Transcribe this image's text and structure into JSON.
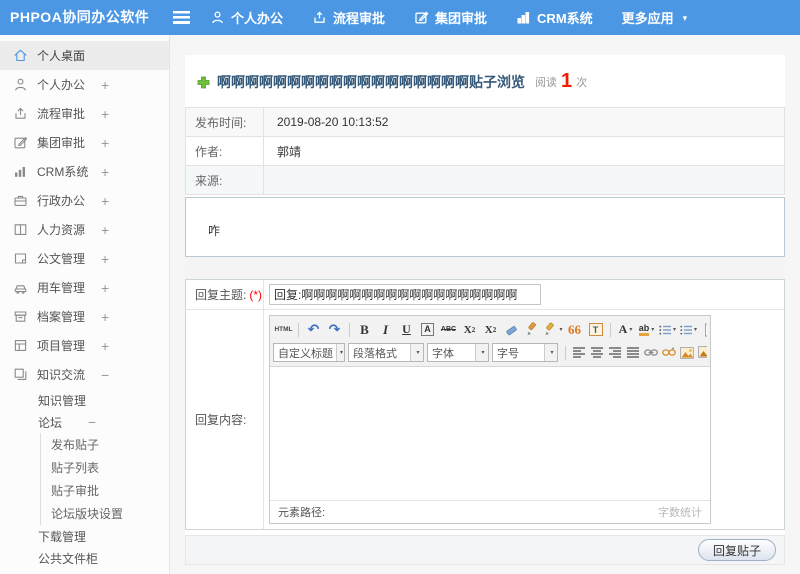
{
  "colors": {
    "topbar_blue": "#4c97e4",
    "title_blue": "#35597a",
    "read_count_red": "#f21d00",
    "plus_green": "#6fbf3f",
    "required_red": "#ff0000"
  },
  "topbar": {
    "brand": "PHPOA协同办公软件",
    "nav": [
      {
        "label": "个人办公",
        "icon": "person-icon"
      },
      {
        "label": "流程审批",
        "icon": "workflow-icon"
      },
      {
        "label": "集团审批",
        "icon": "group-approval-icon"
      },
      {
        "label": "CRM系统",
        "icon": "chart-icon"
      },
      {
        "label": "更多应用",
        "icon": "caret-down-icon"
      }
    ],
    "more_caret": "▾"
  },
  "sidebar": {
    "items": [
      {
        "label": "个人桌面",
        "expand": ""
      },
      {
        "label": "个人办公",
        "expand": "+"
      },
      {
        "label": "流程审批",
        "expand": "+"
      },
      {
        "label": "集团审批",
        "expand": "+"
      },
      {
        "label": "CRM系统",
        "expand": "+"
      },
      {
        "label": "行政办公",
        "expand": "+"
      },
      {
        "label": "人力资源",
        "expand": "+"
      },
      {
        "label": "公文管理",
        "expand": "+"
      },
      {
        "label": "用车管理",
        "expand": "+"
      },
      {
        "label": "档案管理",
        "expand": "+"
      },
      {
        "label": "项目管理",
        "expand": "+"
      },
      {
        "label": "知识交流",
        "expand": "−"
      },
      {
        "label": "知识管理",
        "expand": ""
      },
      {
        "label": "论坛",
        "expand": "−"
      },
      {
        "label": "发布贴子",
        "expand": ""
      },
      {
        "label": "贴子列表",
        "expand": ""
      },
      {
        "label": "贴子审批",
        "expand": ""
      },
      {
        "label": "论坛版块设置",
        "expand": ""
      },
      {
        "label": "下载管理",
        "expand": ""
      },
      {
        "label": "公共文件柜",
        "expand": ""
      }
    ]
  },
  "main": {
    "title": "啊啊啊啊啊啊啊啊啊啊啊啊啊啊啊啊啊啊贴子浏览",
    "read_label": "阅读",
    "read_count": "1",
    "read_unit": "次",
    "info_rows": [
      {
        "label": "发布时间:",
        "value": "2019-08-20 10:13:52"
      },
      {
        "label": "作者:",
        "value": "郭靖"
      },
      {
        "label": "来源:",
        "value": ""
      }
    ],
    "post_content": "咋",
    "reply": {
      "subject_label": "回复主题:",
      "required_mark": "(*)",
      "subject_value": "回复:啊啊啊啊啊啊啊啊啊啊啊啊啊啊啊啊啊啊",
      "content_label": "回复内容:",
      "submit_label": "回复贴子",
      "editor": {
        "glyphs": {
          "html": "HTML",
          "undo": "↶",
          "redo": "↷",
          "bold": "B",
          "italic": "I",
          "underline": "U",
          "box_a": "A",
          "strike": "ABC",
          "sup_base": "X",
          "sup_mark": "2",
          "sub_base": "X",
          "sub_mark": "2",
          "quote": "66",
          "template": "T",
          "font_color": "A",
          "highlight": "ab",
          "caret": "▾"
        },
        "selects": {
          "heading": "自定义标题",
          "paragraph": "段落格式",
          "font": "字体",
          "size": "字号"
        },
        "path_label": "元素路径:",
        "wordcount_label": "字数统计"
      }
    }
  }
}
